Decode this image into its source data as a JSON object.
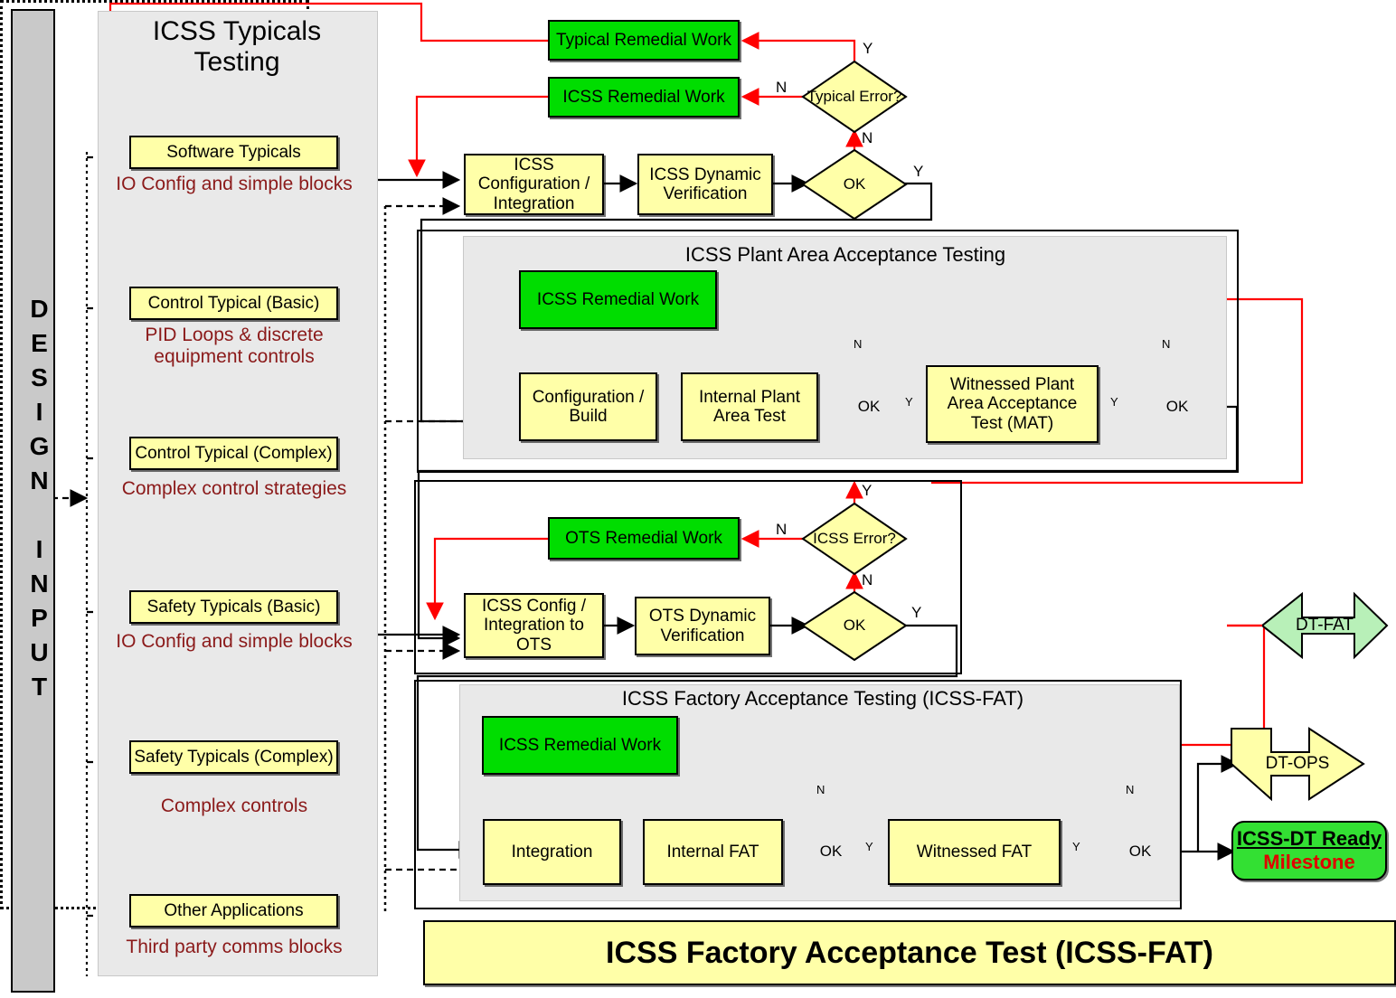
{
  "design_input": {
    "label": "DESIGN INPUT"
  },
  "typicals_column": {
    "title": "ICSS Typicals Testing",
    "items": [
      {
        "label": "Software Typicals",
        "caption": "IO Config and simple blocks"
      },
      {
        "label": "Control Typical (Basic)",
        "caption": "PID Loops & discrete equipment controls"
      },
      {
        "label": "Control Typical (Complex)",
        "caption": "Complex control strategies"
      },
      {
        "label": "Safety Typicals (Basic)",
        "caption": "IO Config and simple blocks"
      },
      {
        "label": "Safety Typicals (Complex)",
        "caption": "Complex controls"
      },
      {
        "label": "Other Applications",
        "caption": "Third party comms blocks"
      }
    ]
  },
  "stage_icss": {
    "remedial_typical": "Typical Remedial Work",
    "remedial_icss": "ICSS Remedial Work",
    "config": "ICSS Configuration / Integration",
    "verify": "ICSS Dynamic Verification",
    "decision_error": "Typical Error?",
    "decision_ok": "OK",
    "lbl_y_top": "Y",
    "lbl_n_left": "N",
    "lbl_n_mid": "N",
    "lbl_y_right": "Y"
  },
  "stage_plant": {
    "title": "ICSS Plant Area Acceptance Testing",
    "remedial": "ICSS Remedial Work",
    "config": "Configuration / Build",
    "internal": "Internal Plant Area Test",
    "witnessed": "Witnessed Plant Area Acceptance Test (MAT)",
    "ok1": "OK",
    "ok2": "OK",
    "lbl_n1": "N",
    "lbl_y1": "Y",
    "lbl_n2": "N",
    "lbl_y2": "Y"
  },
  "stage_ots": {
    "remedial": "OTS Remedial Work",
    "config": "ICSS Config / Integration to OTS",
    "verify": "OTS Dynamic Verification",
    "decision_error": "ICSS Error?",
    "decision_ok": "OK",
    "lbl_y_top": "Y",
    "lbl_n_left": "N",
    "lbl_n_mid": "N",
    "lbl_y_right": "Y"
  },
  "stage_fat": {
    "title": "ICSS Factory Acceptance Testing (ICSS-FAT)",
    "remedial": "ICSS Remedial Work",
    "integration": "Integration",
    "internal": "Internal FAT",
    "witnessed": "Witnessed FAT",
    "ok1": "OK",
    "ok2": "OK",
    "lbl_n1": "N",
    "lbl_y1": "Y",
    "lbl_n2": "N",
    "lbl_y2": "Y"
  },
  "gates": {
    "dt_fat": "DT-FAT",
    "dt_ops": "DT-OPS"
  },
  "milestone": {
    "line1": "ICSS-DT Ready",
    "line2": "Milestone"
  },
  "banner": {
    "title": "ICSS Factory Acceptance Test (ICSS-FAT)"
  },
  "colors": {
    "yellow": "#ffffa8",
    "green": "#00dd00",
    "milestone_green": "#33e033",
    "gate_green": "#b8f0b8",
    "red": "#ff0000",
    "caption_red": "#8b1a1a",
    "panel_gray": "#e9e9e9",
    "design_gray": "#c9c9c9"
  }
}
